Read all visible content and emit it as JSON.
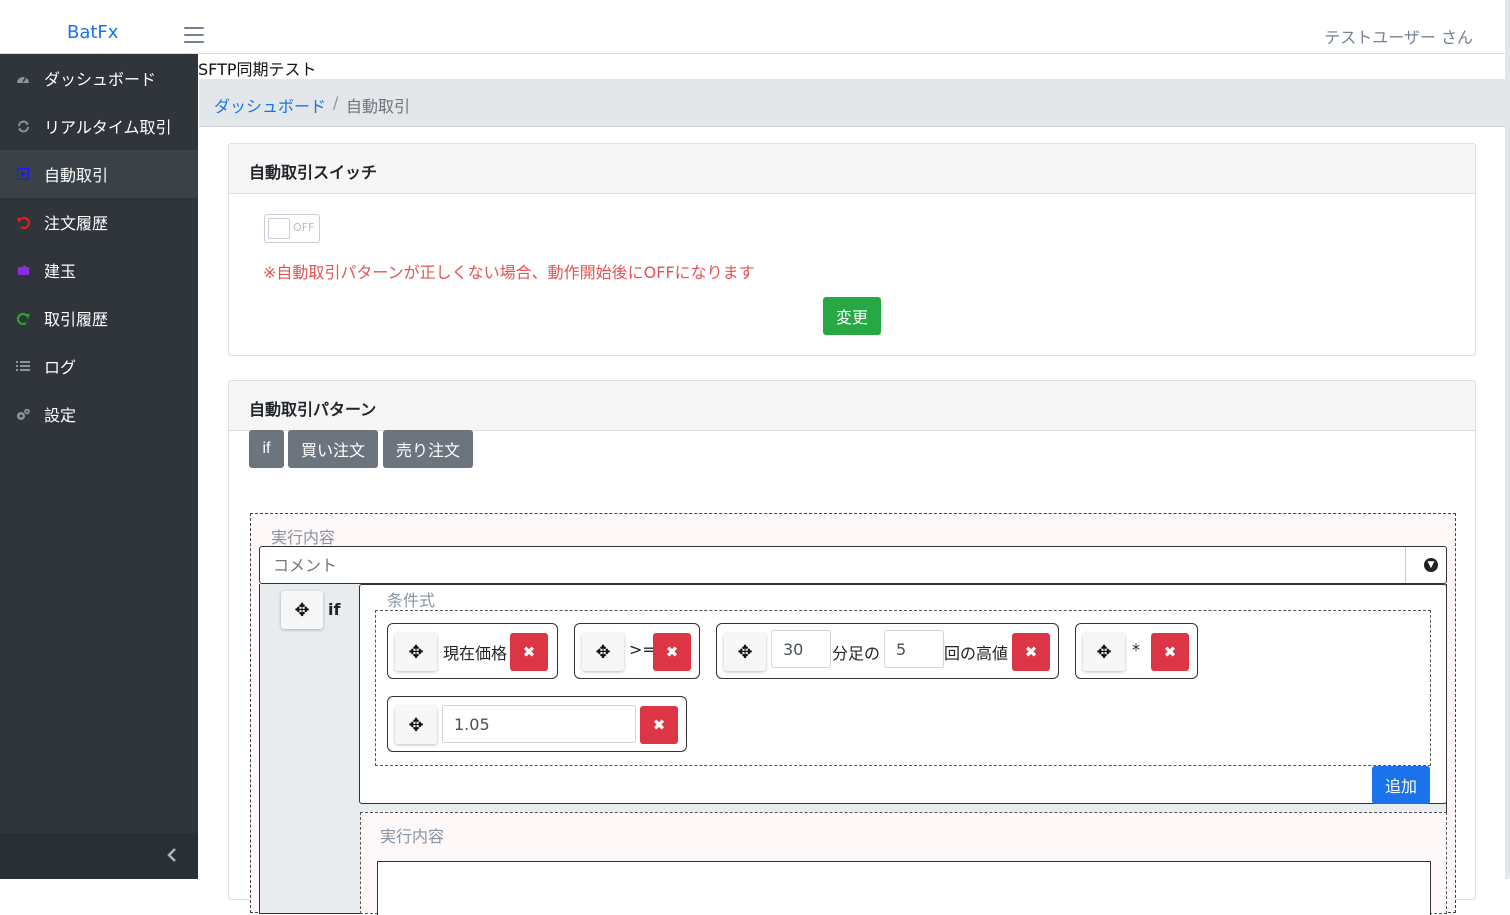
{
  "header": {
    "brand": "BatFx",
    "user": "テストユーザー さん"
  },
  "sidebar": {
    "items": [
      {
        "label": "ダッシュボード",
        "icon": "speedometer-icon",
        "color": "#8a93a2"
      },
      {
        "label": "リアルタイム取引",
        "icon": "refresh-icon",
        "color": "#8a93a2"
      },
      {
        "label": "自動取引",
        "icon": "play-icon",
        "color": "#1a1aff",
        "active": true
      },
      {
        "label": "注文履歴",
        "icon": "undo-icon",
        "color": "#e02020"
      },
      {
        "label": "建玉",
        "icon": "puzzle-icon",
        "color": "#8a2be2"
      },
      {
        "label": "取引履歴",
        "icon": "redo-icon",
        "color": "#1fa82b"
      },
      {
        "label": "ログ",
        "icon": "list-icon",
        "color": "#8a93a2"
      },
      {
        "label": "設定",
        "icon": "gears-icon",
        "color": "#8a93a2"
      }
    ]
  },
  "page_title": "SFTP同期テスト",
  "breadcrumb": {
    "home": "ダッシュボード",
    "separator": "/",
    "current": "自動取引"
  },
  "switch_card": {
    "title": "自動取引スイッチ",
    "toggle_label": "OFF",
    "warning": "※自動取引パターンが正しくない場合、動作開始後にOFFになります",
    "change_button": "変更"
  },
  "pattern_card": {
    "title": "自動取引パターン",
    "buttons": [
      "if",
      "買い注文",
      "売り注文"
    ],
    "exec_label": "実行内容",
    "comment_placeholder": "コメント",
    "if_label": "if",
    "condition_label": "条件式",
    "chips": {
      "price": "現在価格",
      "op": ">=",
      "minutes": "30",
      "minutes_text": "分足の",
      "count": "5",
      "count_text": "回の高値",
      "mult": "*",
      "factor": "1.05"
    },
    "add_button": "追加",
    "exec_label_inner": "実行内容"
  }
}
